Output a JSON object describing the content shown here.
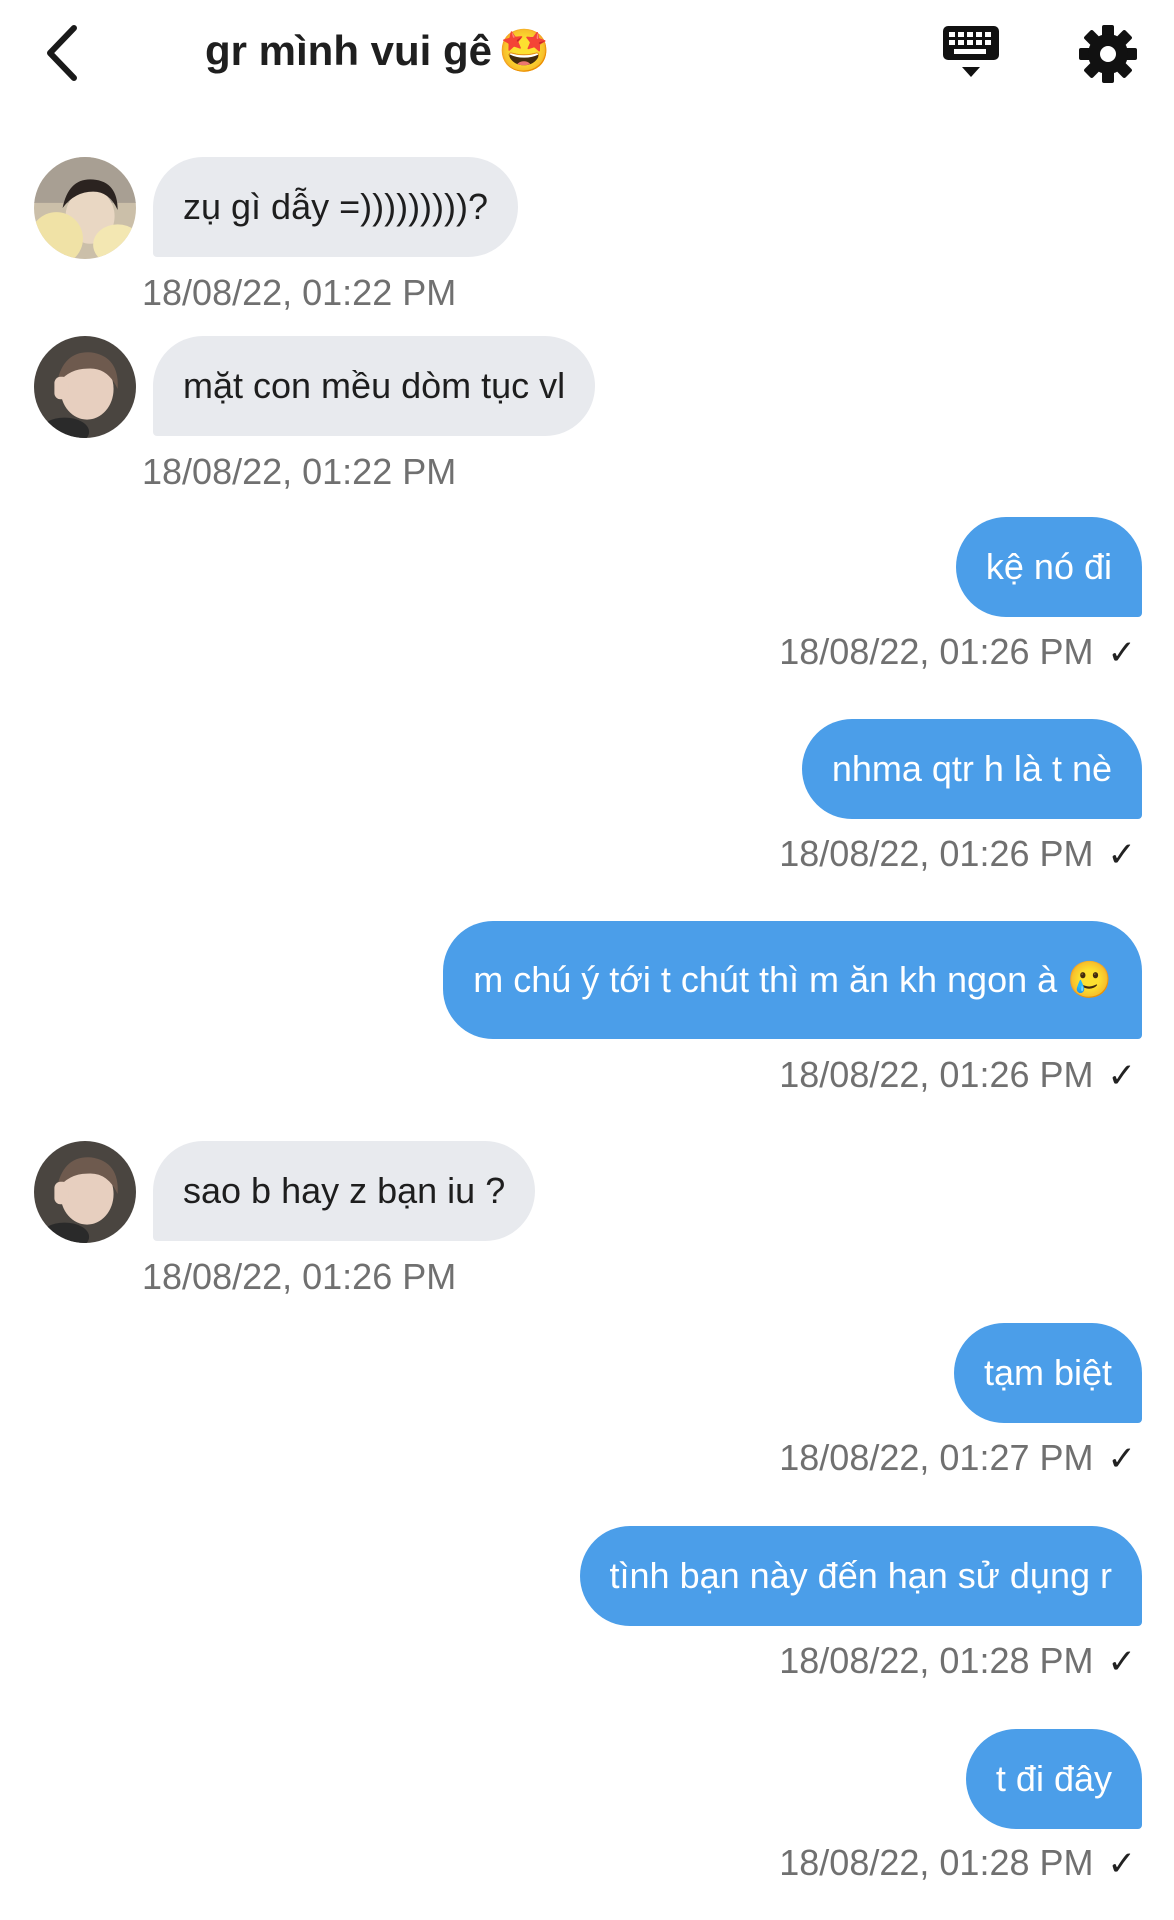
{
  "header": {
    "title": "gr mình vui gê",
    "title_emoji": "🤩",
    "icons": [
      "back-chevron-icon",
      "keyboard-icon",
      "gear-icon"
    ]
  },
  "messages": [
    {
      "dir": "in",
      "avatar": "avatar-1",
      "text": "zụ gì dẫy =)))))))))?",
      "time": "18/08/22, 01:22 PM"
    },
    {
      "dir": "in",
      "avatar": "avatar-2",
      "text": "mặt con mều dòm tục vl",
      "time": "18/08/22, 01:22 PM"
    },
    {
      "dir": "out",
      "text": "kệ nó đi",
      "time": "18/08/22, 01:26 PM",
      "status": "✓"
    },
    {
      "dir": "out",
      "text": "nhma qtr h là t nè",
      "time": "18/08/22, 01:26 PM",
      "status": "✓"
    },
    {
      "dir": "out",
      "text": "m chú ý tới t chút thì m ăn kh ngon à",
      "emoji": "🥲",
      "time": "18/08/22, 01:26 PM",
      "status": "✓"
    },
    {
      "dir": "in",
      "avatar": "avatar-2",
      "text": "sao b hay z bạn iu ?",
      "time": "18/08/22, 01:26 PM"
    },
    {
      "dir": "out",
      "text": "tạm biệt",
      "time": "18/08/22, 01:27 PM",
      "status": "✓"
    },
    {
      "dir": "out",
      "text": "tình bạn này đến hạn sử dụng r",
      "time": "18/08/22, 01:28 PM",
      "status": "✓"
    },
    {
      "dir": "out",
      "text": "t đi đây",
      "time": "18/08/22, 01:28 PM",
      "status": "✓"
    }
  ]
}
